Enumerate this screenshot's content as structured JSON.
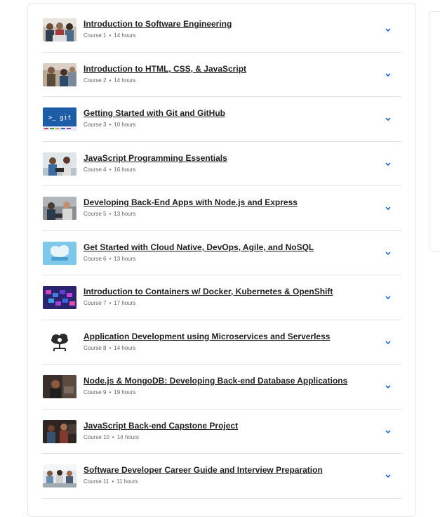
{
  "courses": [
    {
      "title": "Introduction to Software Engineering",
      "label": "Course 1",
      "hours": "14 hours",
      "thumb": "people-laptop"
    },
    {
      "title": "Introduction to HTML, CSS, & JavaScript",
      "label": "Course 2",
      "hours": "14 hours",
      "thumb": "people-office"
    },
    {
      "title": "Getting Started with Git and GitHub",
      "label": "Course 3",
      "hours": "10 hours",
      "thumb": "git-terminal",
      "thumb_text": ">_ git"
    },
    {
      "title": "JavaScript Programming Essentials",
      "label": "Course 4",
      "hours": "16 hours",
      "thumb": "people-desk"
    },
    {
      "title": "Developing Back-End Apps with Node.js and Express",
      "label": "Course 5",
      "hours": "13 hours",
      "thumb": "people-meeting"
    },
    {
      "title": "Get Started with Cloud Native, DevOps, Agile, and NoSQL",
      "label": "Course 6",
      "hours": "13 hours",
      "thumb": "cloud"
    },
    {
      "title": "Introduction to Containers w/ Docker, Kubernetes & OpenShift",
      "label": "Course 7",
      "hours": "17 hours",
      "thumb": "containers"
    },
    {
      "title": "Application Development using Microservices and Serverless",
      "label": "Course 8",
      "hours": "14 hours",
      "thumb": "microservice-cloud"
    },
    {
      "title": "Node.js & MongoDB: Developing Back-end Database Applications",
      "label": "Course 9",
      "hours": "19 hours",
      "thumb": "person-dark"
    },
    {
      "title": "JavaScript Back-end Capstone Project",
      "label": "Course 10",
      "hours": "14 hours",
      "thumb": "people-dark"
    },
    {
      "title": "Software Developer Career Guide and Interview Preparation",
      "label": "Course 11",
      "hours": "11 hours",
      "thumb": "people-table"
    }
  ],
  "colors": {
    "accent": "#0056d2",
    "title": "#1f1f1f",
    "meta": "#636363",
    "divider": "#e0e2e6"
  }
}
